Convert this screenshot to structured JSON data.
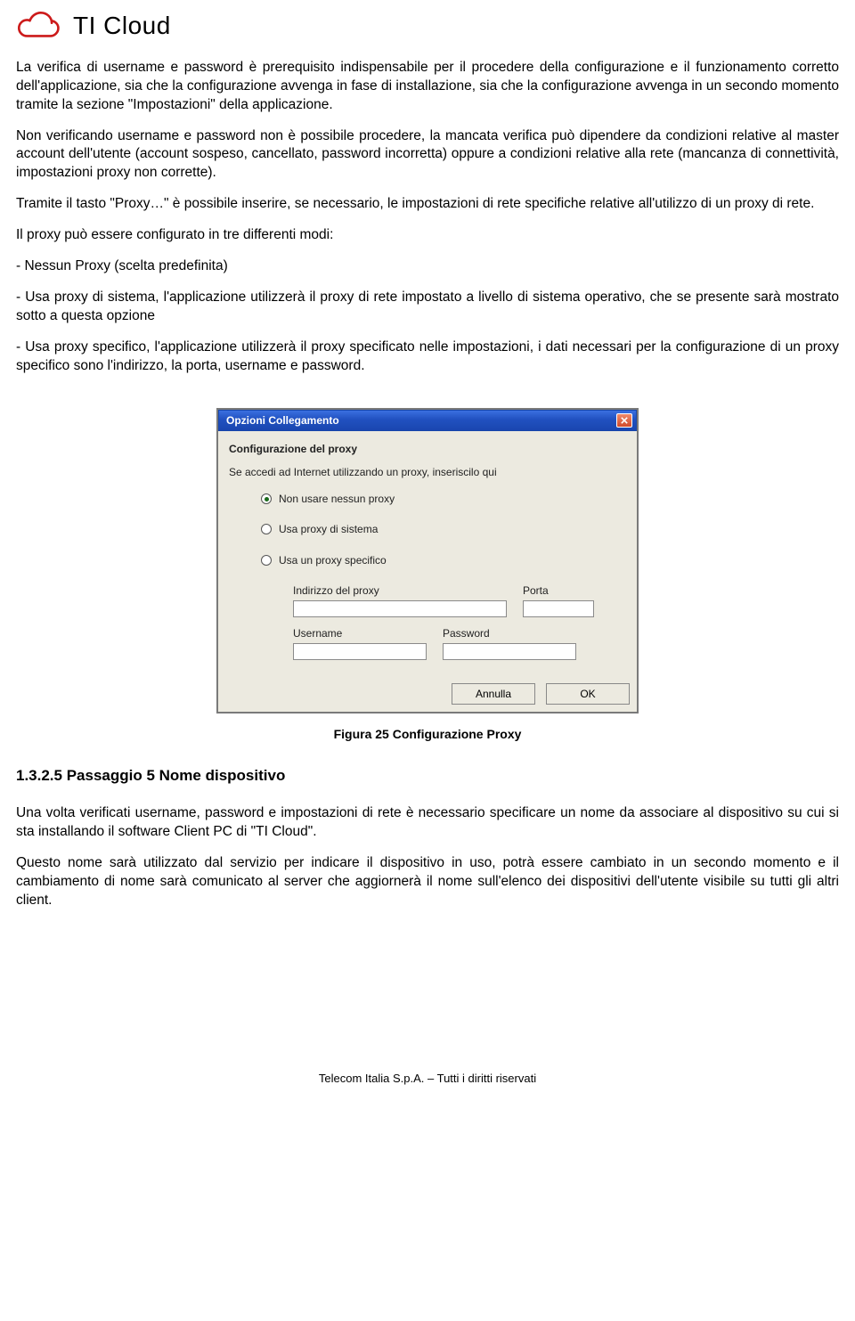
{
  "logo": {
    "text": "TI Cloud"
  },
  "paragraphs": {
    "p1": "La verifica di username e password è prerequisito indispensabile per il procedere della configurazione e il funzionamento corretto dell'applicazione, sia che la configurazione avvenga in fase di installazione, sia che la configurazione avvenga in un secondo momento tramite la sezione \"Impostazioni\" della applicazione.",
    "p2": "Non verificando username e password non è possibile procedere, la mancata verifica può dipendere da condizioni relative al master account dell'utente (account sospeso, cancellato, password incorretta) oppure a condizioni relative alla rete (mancanza di connettività, impostazioni proxy non corrette).",
    "p3": "Tramite il tasto \"Proxy…\" è possibile inserire, se necessario, le impostazioni di rete specifiche relative all'utilizzo di un proxy di rete.",
    "p4": "Il proxy può essere configurato in tre differenti modi:",
    "li1": "- Nessun Proxy (scelta predefinita)",
    "li2": "- Usa proxy di sistema, l'applicazione utilizzerà il proxy di rete impostato a livello di sistema operativo, che se presente sarà mostrato sotto a questa opzione",
    "li3": "- Usa proxy specifico, l'applicazione utilizzerà il proxy specificato nelle impostazioni, i dati necessari per la configurazione di un proxy specifico sono l'indirizzo, la porta, username e password."
  },
  "dialog": {
    "title": "Opzioni Collegamento",
    "group": "Configurazione del proxy",
    "intro": "Se accedi ad Internet utilizzando un proxy, inseriscilo qui",
    "radio1": "Non usare nessun proxy",
    "radio2": "Usa proxy di sistema",
    "radio3": "Usa un proxy specifico",
    "lbl_addr": "Indirizzo del proxy",
    "lbl_port": "Porta",
    "lbl_user": "Username",
    "lbl_pass": "Password",
    "btn_cancel": "Annulla",
    "btn_ok": "OK"
  },
  "caption": "Figura 25 Configurazione Proxy",
  "heading": "1.3.2.5  Passaggio 5 Nome dispositivo",
  "after": {
    "a1": "Una volta verificati username, password e impostazioni di rete è necessario specificare un nome da associare al dispositivo su cui si sta installando il software Client PC di \"TI Cloud\".",
    "a2": "Questo nome sarà utilizzato dal servizio per indicare il dispositivo in uso, potrà essere cambiato in un secondo momento e il cambiamento di nome sarà comunicato al server che aggiornerà il nome sull'elenco dei dispositivi dell'utente visibile su tutti gli altri client."
  },
  "footer": "Telecom Italia S.p.A. – Tutti i diritti riservati"
}
